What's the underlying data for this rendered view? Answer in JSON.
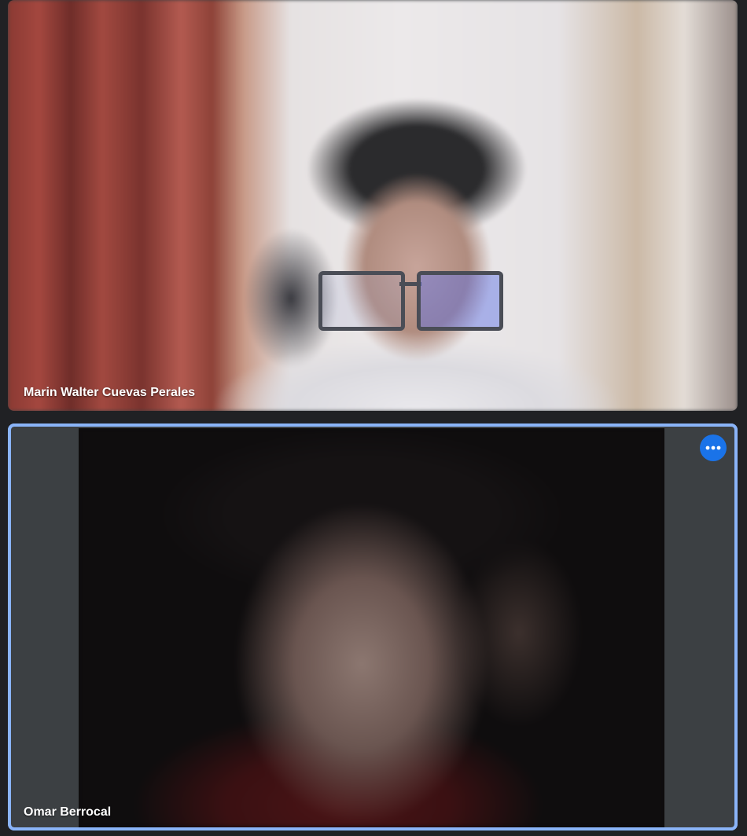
{
  "participants": [
    {
      "name": "Marin Walter Cuevas Perales",
      "active_speaker": false
    },
    {
      "name": "Omar Berrocal",
      "active_speaker": true,
      "more_options_icon": "more-horizontal-icon"
    }
  ],
  "colors": {
    "background": "#202124",
    "tile_background": "#3c4043",
    "active_border": "#8ab4f8",
    "more_button": "#1a73e8",
    "label_text": "#ffffff"
  }
}
